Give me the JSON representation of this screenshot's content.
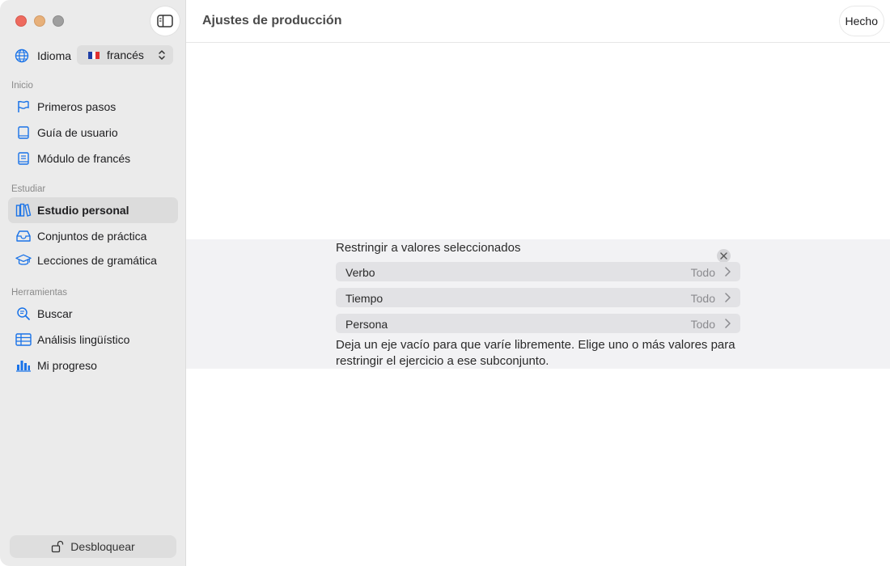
{
  "window": {
    "title": "Ajustes de producción",
    "done_label": "Hecho"
  },
  "sidebar": {
    "language_label": "Idioma",
    "language_value": "francés",
    "sections": {
      "inicio": "Inicio",
      "estudiar": "Estudiar",
      "herramientas": "Herramientas"
    },
    "items": [
      {
        "label": "Primeros pasos",
        "icon": "flag-icon"
      },
      {
        "label": "Guía de usuario",
        "icon": "book-icon"
      },
      {
        "label": "Módulo de francés",
        "icon": "module-book-icon"
      },
      {
        "label": "Estudio personal",
        "icon": "books-icon",
        "active": true
      },
      {
        "label": "Conjuntos de práctica",
        "icon": "tray-icon"
      },
      {
        "label": "Lecciones de gramática",
        "icon": "graduation-cap-icon"
      },
      {
        "label": "Buscar",
        "icon": "search-icon"
      },
      {
        "label": "Análisis lingüístico",
        "icon": "table-icon"
      },
      {
        "label": "Mi progreso",
        "icon": "bar-chart-icon"
      }
    ],
    "unlock_label": "Desbloquear"
  },
  "panel": {
    "title": "Restringir a valores seleccionados",
    "rows": [
      {
        "label": "Verbo",
        "value": "Todo"
      },
      {
        "label": "Tiempo",
        "value": "Todo"
      },
      {
        "label": "Persona",
        "value": "Todo"
      }
    ],
    "help": "Deja un eje vacío para que varíe libremente. Elige uno o más valores para restringir el ejercicio a ese subconjunto."
  },
  "colors": {
    "accent": "#1a73e8",
    "sidebar_bg": "#ebebeb",
    "panel_bg": "#f2f2f4"
  }
}
